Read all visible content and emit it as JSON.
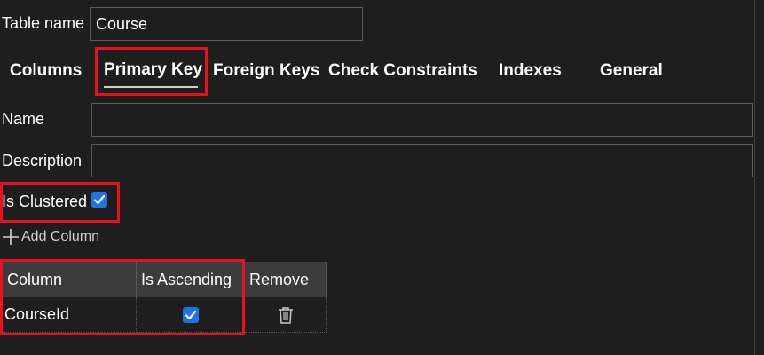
{
  "table_name": {
    "label": "Table name",
    "value": "Course"
  },
  "tabs": [
    {
      "label": "Columns"
    },
    {
      "label": "Primary Key"
    },
    {
      "label": "Foreign Keys"
    },
    {
      "label": "Check Constraints"
    },
    {
      "label": "Indexes"
    },
    {
      "label": "General"
    }
  ],
  "active_tab": "Primary Key",
  "form": {
    "name_label": "Name",
    "name_value": "",
    "description_label": "Description",
    "description_value": "",
    "is_clustered_label": "Is Clustered",
    "is_clustered_checked": true
  },
  "add_column_label": "Add Column",
  "grid": {
    "headers": [
      "Column",
      "Is Ascending",
      "Remove"
    ],
    "rows": [
      {
        "column": "CourseId",
        "is_ascending": true,
        "remove_icon": "trash-icon"
      }
    ]
  },
  "colors": {
    "highlight": "#e81123",
    "checkbox": "#1e74e3",
    "background": "#1e1e1e"
  }
}
